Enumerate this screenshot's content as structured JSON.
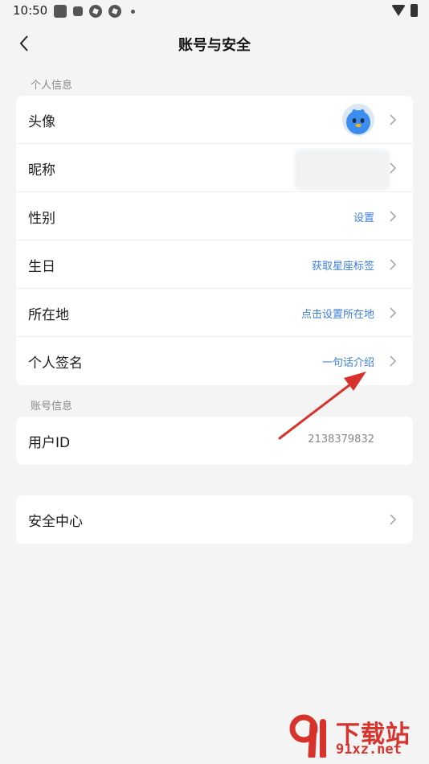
{
  "status": {
    "time": "10:50"
  },
  "header": {
    "title": "账号与安全"
  },
  "personal_section": {
    "title": "个人信息",
    "items": [
      {
        "label": "头像",
        "value": ""
      },
      {
        "label": "昵称",
        "value": ""
      },
      {
        "label": "性别",
        "value": "设置"
      },
      {
        "label": "生日",
        "value": "获取星座标签"
      },
      {
        "label": "所在地",
        "value": "点击设置所在地"
      },
      {
        "label": "个人签名",
        "value": "一句话介绍"
      }
    ]
  },
  "account_section": {
    "title": "账号信息",
    "items": [
      {
        "label": "用户ID",
        "value": "2138379832"
      }
    ]
  },
  "security": {
    "label": "安全中心"
  },
  "colors": {
    "accent": "#3d7fe0",
    "arrow": "#d8322c",
    "background": "#f4f4f4"
  },
  "watermark": {
    "text": "下载站",
    "url": "91xz.net"
  }
}
